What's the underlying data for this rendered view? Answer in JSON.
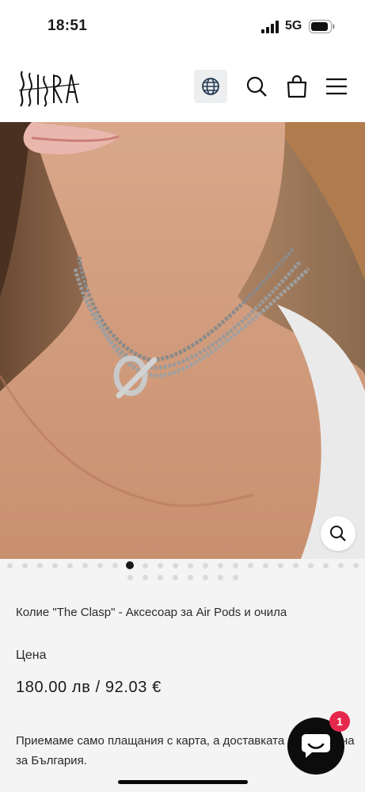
{
  "status_bar": {
    "time": "18:51",
    "network": "5G"
  },
  "header": {
    "logo_text": "ISSIRA",
    "icons": [
      "globe-icon",
      "search-icon",
      "bag-icon",
      "menu-icon"
    ]
  },
  "product": {
    "title": "Колие \"The Clasp\" - Аксесоар за Air Pods и очила",
    "price_label": "Цена",
    "price": "180.00 лв / 92.03 €",
    "note": "Приемаме само плащания с карта, а доставката е безплатна за България."
  },
  "gallery": {
    "total_images": 32,
    "active_index": 8
  },
  "chat": {
    "badge_count": "1"
  },
  "colors": {
    "accent": "#1a1a1a",
    "badge": "#e5284b",
    "background": "#f4f4f4"
  }
}
